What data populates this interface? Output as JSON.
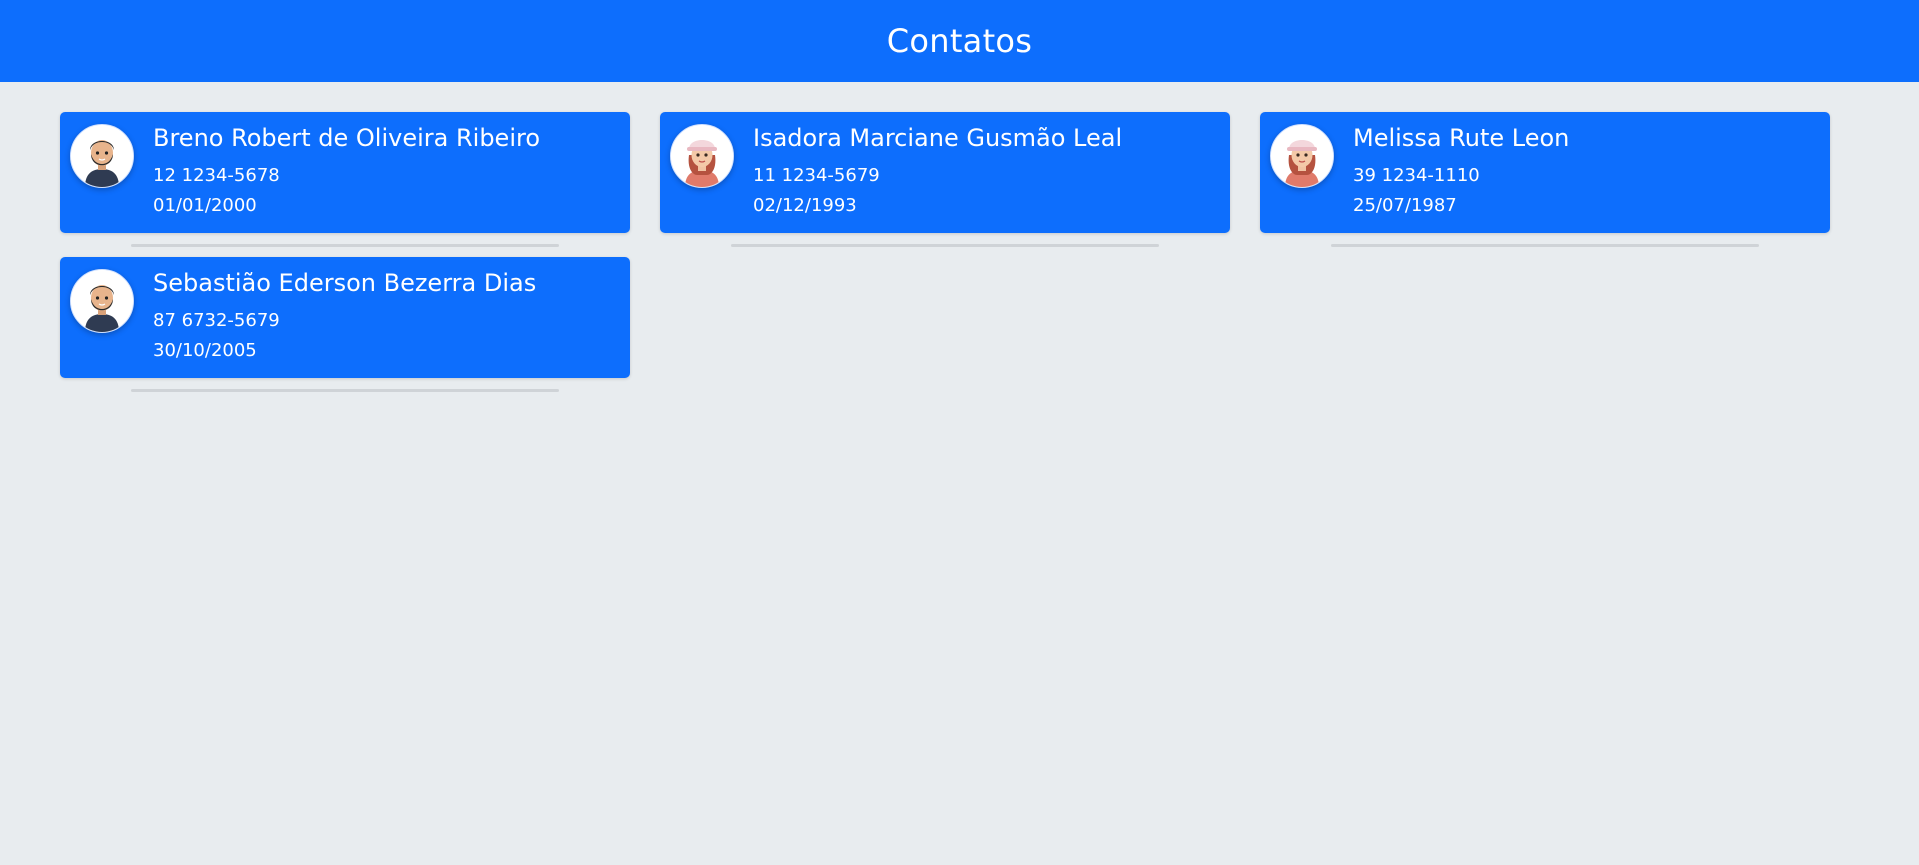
{
  "header": {
    "title": "Contatos"
  },
  "colors": {
    "primary": "#0d6efd",
    "background": "#e8ecef",
    "divider": "#cfd3d7"
  },
  "contacts": [
    {
      "name": "Breno Robert de Oliveira Ribeiro",
      "phone": "12 1234-5678",
      "birthdate": "01/01/2000",
      "avatar_icon": "male-avatar-icon"
    },
    {
      "name": "Isadora Marciane Gusmão Leal",
      "phone": "11 1234-5679",
      "birthdate": "02/12/1993",
      "avatar_icon": "female-avatar-icon"
    },
    {
      "name": "Melissa Rute Leon",
      "phone": "39 1234-1110",
      "birthdate": "25/07/1987",
      "avatar_icon": "female-avatar-icon"
    },
    {
      "name": "Sebastião Ederson Bezerra Dias",
      "phone": "87 6732-5679",
      "birthdate": "30/10/2005",
      "avatar_icon": "male-avatar-icon"
    }
  ]
}
